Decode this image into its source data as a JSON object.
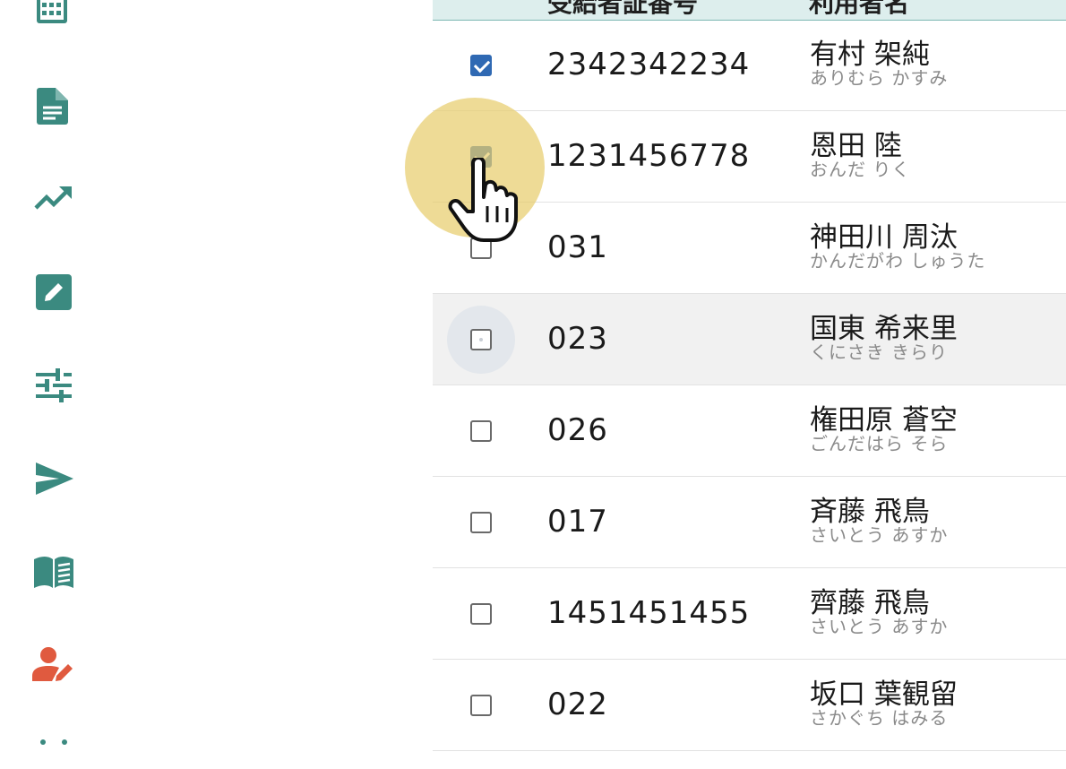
{
  "sidebar": {
    "items": [
      {
        "icon": "calendar-icon",
        "color": "#3b8a80"
      },
      {
        "icon": "document-icon",
        "color": "#3b8a80"
      },
      {
        "icon": "trending-up-icon",
        "color": "#3b8a80"
      },
      {
        "icon": "edit-square-icon",
        "color": "#3b8a80"
      },
      {
        "icon": "tune-sliders-icon",
        "color": "#3b8a80"
      },
      {
        "icon": "send-icon",
        "color": "#3b8a80"
      },
      {
        "icon": "open-book-icon",
        "color": "#3b8a80"
      },
      {
        "icon": "user-edit-icon",
        "color": "#e05a3f"
      },
      {
        "icon": "more-icon",
        "color": "#3b8a80"
      }
    ]
  },
  "table": {
    "headers": {
      "recipient_number": "受給者証番号",
      "user_name": "利用者名"
    },
    "rows": [
      {
        "checked": true,
        "number": "2342342234",
        "name": "有村 架純",
        "kana": "ありむら かすみ"
      },
      {
        "checked": true,
        "number": "1231456778",
        "name": "恩田 陸",
        "kana": "おんだ りく"
      },
      {
        "checked": false,
        "number": "031",
        "name": "神田川 周汰",
        "kana": "かんだがわ しゅうた"
      },
      {
        "checked": false,
        "number": "023",
        "name": "国東 希来里",
        "kana": "くにさき きらり"
      },
      {
        "checked": false,
        "number": "026",
        "name": "権田原 蒼空",
        "kana": "ごんだはら そら"
      },
      {
        "checked": false,
        "number": "017",
        "name": "斉藤 飛鳥",
        "kana": "さいとう あすか"
      },
      {
        "checked": false,
        "number": "1451451455",
        "name": "齊藤 飛鳥",
        "kana": "さいとう あすか"
      },
      {
        "checked": false,
        "number": "022",
        "name": "坂口 葉観留",
        "kana": "さかぐち はみる"
      }
    ]
  },
  "colors": {
    "accent": "#3b8a80",
    "checkbox_checked": "#2f69b3",
    "header_bg": "#ddeeed",
    "cursor_highlight": "#e8cd6e"
  }
}
